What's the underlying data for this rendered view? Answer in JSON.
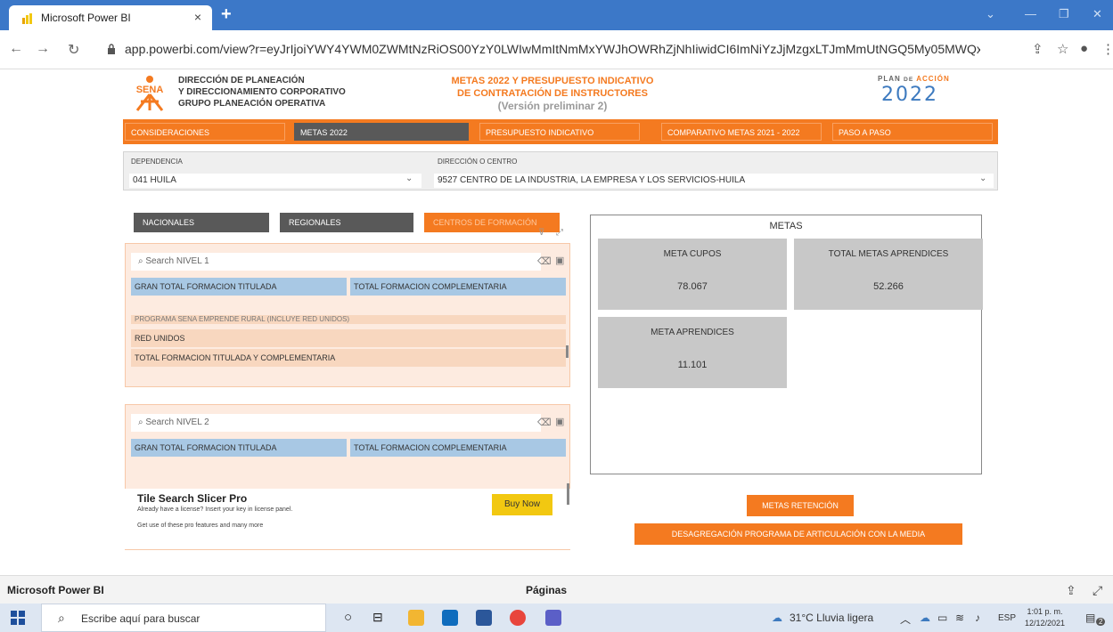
{
  "browser": {
    "tab_title": "Microsoft Power BI",
    "tab_close": "×",
    "new_tab": "+",
    "url": "app.powerbi.com/view?r=eyJrIjoiYWY4YWM0ZWMtNzRiOS00YzY0LWIwMmItNmMxYWJhOWRhZjNhIiwidCI6ImNiYzJjMzgxLTJmMmUtNGQ5My05MWQxLTUwNmM5MzE2YW..."
  },
  "header": {
    "org_lines": [
      "DIRECCIÓN DE PLANEACIÓN",
      "Y DIRECCIONAMIENTO CORPORATIVO",
      "GRUPO PLANEACIÓN OPERATIVA"
    ],
    "title_line1": "METAS 2022 Y PRESUPUESTO INDICATIVO",
    "title_line2": "DE CONTRATACIÓN DE INSTRUCTORES",
    "title_line3": "(Versión preliminar 2)",
    "plan_prefix": "PLAN",
    "plan_de": "DE",
    "plan_accion": "ACCIÓN",
    "plan_year": "2022",
    "sena_text": "SENA"
  },
  "nav": [
    {
      "label": "CONSIDERACIONES",
      "active": false
    },
    {
      "label": "METAS 2022",
      "active": true
    },
    {
      "label": "PRESUPUESTO INDICATIVO",
      "active": false
    },
    {
      "label": "COMPARATIVO METAS 2021 - 2022",
      "active": false
    },
    {
      "label": "PASO A PASO",
      "active": false
    }
  ],
  "filters": {
    "dependencia_label": "DEPENDENCIA",
    "dependencia_value": "041 HUILA",
    "centro_label": "DIRECCIÓN O CENTRO",
    "centro_value": "9527 CENTRO DE LA INDUSTRIA, LA EMPRESA Y LOS SERVICIOS-HUILA"
  },
  "toggles": [
    "NACIONALES",
    "REGIONALES",
    "CENTROS DE FORMACIÓN"
  ],
  "slicer1": {
    "search_placeholder": "Search NIVEL 1",
    "col1": "GRAN TOTAL FORMACION TITULADA",
    "col2": "TOTAL FORMACION COMPLEMENTARIA",
    "rows": [
      "PROGRAMA SENA EMPRENDE RURAL (INCLUYE RED UNIDOS)",
      "RED UNIDOS",
      "TOTAL FORMACION TITULADA Y COMPLEMENTARIA"
    ]
  },
  "slicer2": {
    "search_placeholder": "Search NIVEL 2",
    "col1": "GRAN TOTAL FORMACION TITULADA",
    "col2": "TOTAL FORMACION COMPLEMENTARIA"
  },
  "promo": {
    "title": "Tile Search Slicer Pro",
    "line1": "Already have a license? Insert your key in license panel.",
    "line2": "Get use of these pro features and many more",
    "buy": "Buy Now"
  },
  "metas": {
    "title": "METAS",
    "cards": [
      {
        "label": "META CUPOS",
        "value": "78.067"
      },
      {
        "label": "TOTAL METAS APRENDICES",
        "value": "52.266"
      },
      {
        "label": "META APRENDICES",
        "value": "11.101"
      }
    ]
  },
  "buttons": {
    "retencion": "METAS RETENCIÓN",
    "desagregacion": "DESAGREGACIÓN PROGRAMA DE ARTICULACIÓN CON LA MEDIA"
  },
  "pbi_bar": {
    "left": "Microsoft Power BI",
    "center": "Páginas"
  },
  "taskbar": {
    "search": "Escribe aquí para buscar",
    "weather": "31°C  Lluvia ligera",
    "lang": "ESP",
    "time": "1:01 p. m.",
    "date": "12/12/2021",
    "notif": "2"
  },
  "colors": {
    "accent": "#f47a20",
    "browser_blue": "#3c78c8",
    "card_gray": "#c8c8c8"
  }
}
